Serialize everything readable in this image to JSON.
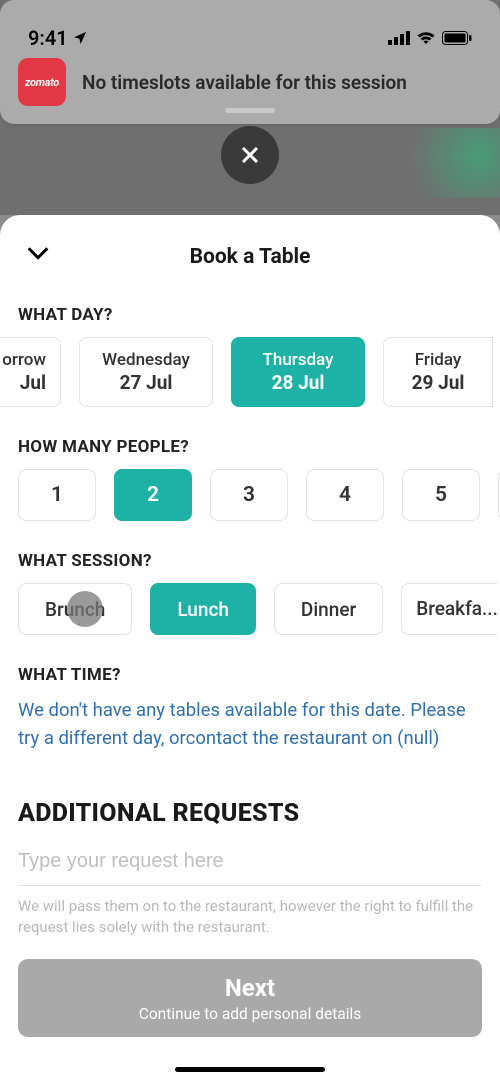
{
  "status": {
    "time": "9:41"
  },
  "banner": {
    "logo": "zomato",
    "text": "No timeslots available for this session"
  },
  "sheet": {
    "title": "Book a Table",
    "what_day": "WHAT DAY?",
    "days": [
      {
        "weekday": "orrow",
        "date": "Jul"
      },
      {
        "weekday": "Wednesday",
        "date": "27 Jul"
      },
      {
        "weekday": "Thursday",
        "date": "28 Jul",
        "selected": true
      },
      {
        "weekday": "Friday",
        "date": "29 Jul"
      }
    ],
    "how_many": "HOW MANY PEOPLE?",
    "people": [
      "1",
      "2",
      "3",
      "4",
      "5"
    ],
    "people_selected": "2",
    "what_session": "WHAT SESSION?",
    "sessions": [
      "Brunch",
      "Lunch",
      "Dinner",
      "Breakfa..."
    ],
    "session_selected": "Lunch",
    "what_time": "WHAT TIME?",
    "time_msg": "We don't have any tables available for this date. Please try a different day, orcontact the restaurant on (null)",
    "addl_heading": "ADDITIONAL REQUESTS",
    "request_placeholder": "Type your request here",
    "disclaimer": "We will pass them on to the restaurant, however the right to fulfill the request lies solely with the restaurant.",
    "next": {
      "title": "Next",
      "sub": "Continue to add personal details"
    }
  }
}
